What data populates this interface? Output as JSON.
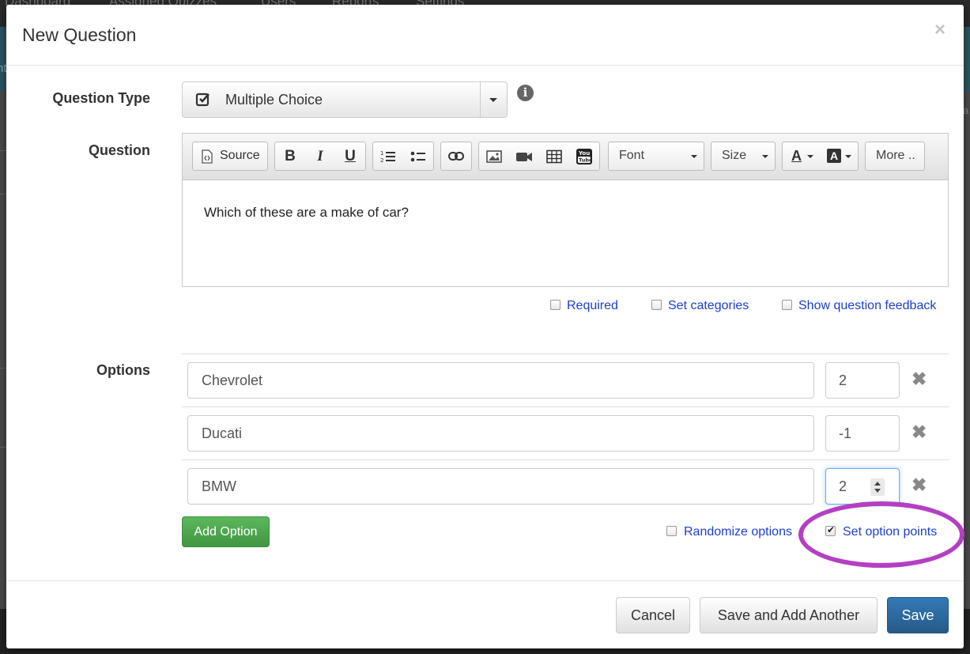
{
  "background": {
    "nav_items": [
      "Dashboard",
      "Assigned Quizzes",
      "Users",
      "Reports",
      "Settings"
    ],
    "band_text": "nt",
    "right_text": "a"
  },
  "modal": {
    "title": "New Question",
    "close_glyph": "×"
  },
  "question_type": {
    "label": "Question Type",
    "selected": "Multiple Choice",
    "info_glyph": "i"
  },
  "question": {
    "label": "Question",
    "toolbar": {
      "source_label": "Source",
      "bold": "B",
      "italic": "I",
      "underline": "U",
      "font_label": "Font",
      "size_label": "Size",
      "text_color": "A",
      "bg_color": "A",
      "more_label": "More .."
    },
    "content": "Which of these are a make of car?"
  },
  "question_flags": [
    {
      "label": "Required",
      "checked": false
    },
    {
      "label": "Set categories",
      "checked": false
    },
    {
      "label": "Show question feedback",
      "checked": false
    }
  ],
  "options": {
    "label": "Options",
    "items": [
      {
        "text": "Chevrolet",
        "points": "2"
      },
      {
        "text": "Ducati",
        "points": "-1"
      },
      {
        "text": "BMW",
        "points": "2"
      }
    ],
    "remove_glyph": "✖",
    "add_label": "Add Option",
    "randomize": {
      "label": "Randomize options",
      "checked": false
    },
    "set_points": {
      "label": "Set option points",
      "checked": true
    }
  },
  "footer": {
    "cancel_label": "Cancel",
    "save_another_label": "Save and Add Another",
    "save_label": "Save"
  },
  "colors": {
    "primary": "#337ab7",
    "success": "#5cb85c",
    "link": "#1a3fd1",
    "highlight": "#b43fc4"
  }
}
